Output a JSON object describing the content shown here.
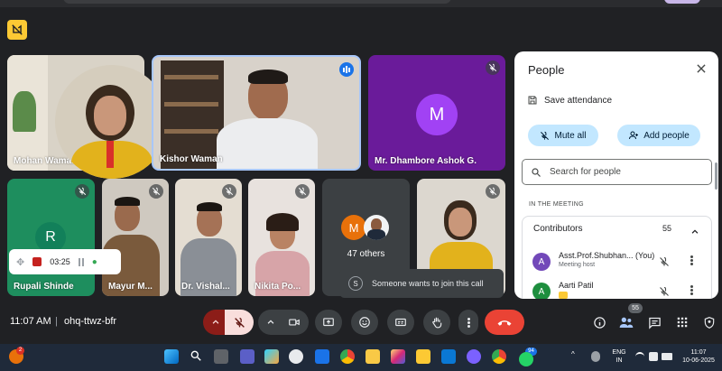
{
  "meeting": {
    "time": "11:07 AM",
    "separator": "|",
    "code": "ohq-ttwz-bfr"
  },
  "participants": {
    "mohan": "Mohan Waman",
    "kishor": "Kishor Waman",
    "dhambore": {
      "name": "Mr. Dhambore Ashok G.",
      "initial": "M"
    },
    "rupali": {
      "name": "Rupali Shinde",
      "initial": "R"
    },
    "mayur": "Mayur M...",
    "vishal": "Dr. Vishal...",
    "nikita": "Nikita Po...",
    "others": {
      "label": "47 others",
      "initial": "M"
    }
  },
  "recording": {
    "timer": "03:25"
  },
  "toast": {
    "initial": "S",
    "text": "Someone wants to join this call"
  },
  "people_panel": {
    "title": "People",
    "save_attendance": "Save attendance",
    "mute_all": "Mute all",
    "add_people": "Add people",
    "search_placeholder": "Search for people",
    "section_label": "IN THE MEETING",
    "contributors_label": "Contributors",
    "contributors_count": "55",
    "rows": [
      {
        "initial": "A",
        "name": "Asst.Prof.Shubhan... (You)",
        "sub": "Meeting host"
      },
      {
        "initial": "A",
        "name": "Aarti Patil",
        "sub": ""
      }
    ]
  },
  "controls": {
    "people_badge": "55"
  },
  "taskbar": {
    "notification_count": "2",
    "chrome_badge": "94",
    "lang": "ENG",
    "region": "IN",
    "clock_time": "11:07",
    "clock_date": "10-06-2025"
  },
  "colors": {
    "accent_blue": "#c2e7ff",
    "end_call_red": "#ea4335",
    "purple_tile": "#6a1b9a",
    "rupali_green": "#1e8e5e"
  }
}
